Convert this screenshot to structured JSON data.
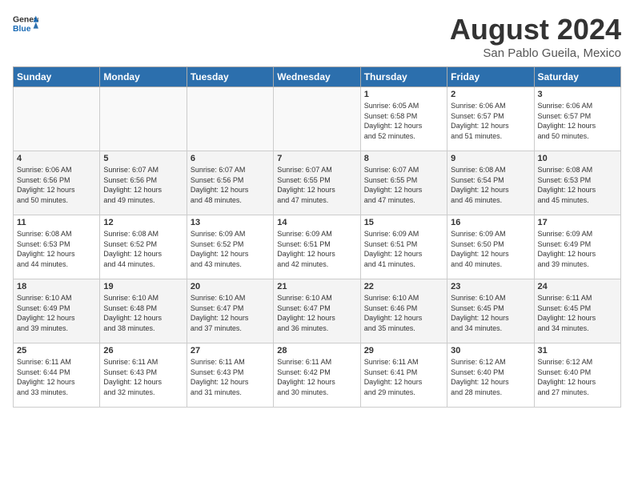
{
  "header": {
    "logo_general": "General",
    "logo_blue": "Blue",
    "month_year": "August 2024",
    "location": "San Pablo Gueila, Mexico"
  },
  "weekdays": [
    "Sunday",
    "Monday",
    "Tuesday",
    "Wednesday",
    "Thursday",
    "Friday",
    "Saturday"
  ],
  "weeks": [
    [
      {
        "day": "",
        "info": "",
        "empty": true
      },
      {
        "day": "",
        "info": "",
        "empty": true
      },
      {
        "day": "",
        "info": "",
        "empty": true
      },
      {
        "day": "",
        "info": "",
        "empty": true
      },
      {
        "day": "1",
        "info": "Sunrise: 6:05 AM\nSunset: 6:58 PM\nDaylight: 12 hours\nand 52 minutes.",
        "empty": false
      },
      {
        "day": "2",
        "info": "Sunrise: 6:06 AM\nSunset: 6:57 PM\nDaylight: 12 hours\nand 51 minutes.",
        "empty": false
      },
      {
        "day": "3",
        "info": "Sunrise: 6:06 AM\nSunset: 6:57 PM\nDaylight: 12 hours\nand 50 minutes.",
        "empty": false
      }
    ],
    [
      {
        "day": "4",
        "info": "Sunrise: 6:06 AM\nSunset: 6:56 PM\nDaylight: 12 hours\nand 50 minutes.",
        "empty": false
      },
      {
        "day": "5",
        "info": "Sunrise: 6:07 AM\nSunset: 6:56 PM\nDaylight: 12 hours\nand 49 minutes.",
        "empty": false
      },
      {
        "day": "6",
        "info": "Sunrise: 6:07 AM\nSunset: 6:56 PM\nDaylight: 12 hours\nand 48 minutes.",
        "empty": false
      },
      {
        "day": "7",
        "info": "Sunrise: 6:07 AM\nSunset: 6:55 PM\nDaylight: 12 hours\nand 47 minutes.",
        "empty": false
      },
      {
        "day": "8",
        "info": "Sunrise: 6:07 AM\nSunset: 6:55 PM\nDaylight: 12 hours\nand 47 minutes.",
        "empty": false
      },
      {
        "day": "9",
        "info": "Sunrise: 6:08 AM\nSunset: 6:54 PM\nDaylight: 12 hours\nand 46 minutes.",
        "empty": false
      },
      {
        "day": "10",
        "info": "Sunrise: 6:08 AM\nSunset: 6:53 PM\nDaylight: 12 hours\nand 45 minutes.",
        "empty": false
      }
    ],
    [
      {
        "day": "11",
        "info": "Sunrise: 6:08 AM\nSunset: 6:53 PM\nDaylight: 12 hours\nand 44 minutes.",
        "empty": false
      },
      {
        "day": "12",
        "info": "Sunrise: 6:08 AM\nSunset: 6:52 PM\nDaylight: 12 hours\nand 44 minutes.",
        "empty": false
      },
      {
        "day": "13",
        "info": "Sunrise: 6:09 AM\nSunset: 6:52 PM\nDaylight: 12 hours\nand 43 minutes.",
        "empty": false
      },
      {
        "day": "14",
        "info": "Sunrise: 6:09 AM\nSunset: 6:51 PM\nDaylight: 12 hours\nand 42 minutes.",
        "empty": false
      },
      {
        "day": "15",
        "info": "Sunrise: 6:09 AM\nSunset: 6:51 PM\nDaylight: 12 hours\nand 41 minutes.",
        "empty": false
      },
      {
        "day": "16",
        "info": "Sunrise: 6:09 AM\nSunset: 6:50 PM\nDaylight: 12 hours\nand 40 minutes.",
        "empty": false
      },
      {
        "day": "17",
        "info": "Sunrise: 6:09 AM\nSunset: 6:49 PM\nDaylight: 12 hours\nand 39 minutes.",
        "empty": false
      }
    ],
    [
      {
        "day": "18",
        "info": "Sunrise: 6:10 AM\nSunset: 6:49 PM\nDaylight: 12 hours\nand 39 minutes.",
        "empty": false
      },
      {
        "day": "19",
        "info": "Sunrise: 6:10 AM\nSunset: 6:48 PM\nDaylight: 12 hours\nand 38 minutes.",
        "empty": false
      },
      {
        "day": "20",
        "info": "Sunrise: 6:10 AM\nSunset: 6:47 PM\nDaylight: 12 hours\nand 37 minutes.",
        "empty": false
      },
      {
        "day": "21",
        "info": "Sunrise: 6:10 AM\nSunset: 6:47 PM\nDaylight: 12 hours\nand 36 minutes.",
        "empty": false
      },
      {
        "day": "22",
        "info": "Sunrise: 6:10 AM\nSunset: 6:46 PM\nDaylight: 12 hours\nand 35 minutes.",
        "empty": false
      },
      {
        "day": "23",
        "info": "Sunrise: 6:10 AM\nSunset: 6:45 PM\nDaylight: 12 hours\nand 34 minutes.",
        "empty": false
      },
      {
        "day": "24",
        "info": "Sunrise: 6:11 AM\nSunset: 6:45 PM\nDaylight: 12 hours\nand 34 minutes.",
        "empty": false
      }
    ],
    [
      {
        "day": "25",
        "info": "Sunrise: 6:11 AM\nSunset: 6:44 PM\nDaylight: 12 hours\nand 33 minutes.",
        "empty": false
      },
      {
        "day": "26",
        "info": "Sunrise: 6:11 AM\nSunset: 6:43 PM\nDaylight: 12 hours\nand 32 minutes.",
        "empty": false
      },
      {
        "day": "27",
        "info": "Sunrise: 6:11 AM\nSunset: 6:43 PM\nDaylight: 12 hours\nand 31 minutes.",
        "empty": false
      },
      {
        "day": "28",
        "info": "Sunrise: 6:11 AM\nSunset: 6:42 PM\nDaylight: 12 hours\nand 30 minutes.",
        "empty": false
      },
      {
        "day": "29",
        "info": "Sunrise: 6:11 AM\nSunset: 6:41 PM\nDaylight: 12 hours\nand 29 minutes.",
        "empty": false
      },
      {
        "day": "30",
        "info": "Sunrise: 6:12 AM\nSunset: 6:40 PM\nDaylight: 12 hours\nand 28 minutes.",
        "empty": false
      },
      {
        "day": "31",
        "info": "Sunrise: 6:12 AM\nSunset: 6:40 PM\nDaylight: 12 hours\nand 27 minutes.",
        "empty": false
      }
    ]
  ]
}
